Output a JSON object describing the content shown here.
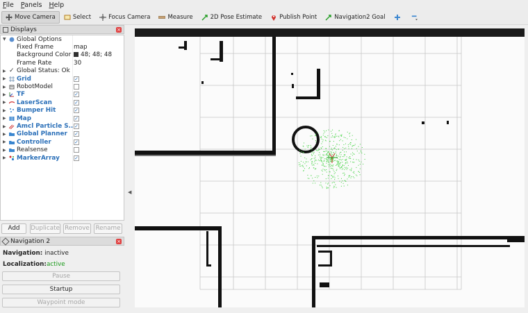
{
  "menubar": [
    "File",
    "Panels",
    "Help"
  ],
  "toolbar": {
    "tools": [
      "Move Camera",
      "Select",
      "Focus Camera",
      "Measure",
      "2D Pose Estimate",
      "Publish Point",
      "Navigation2 Goal"
    ]
  },
  "displays": {
    "title": "Displays",
    "rows": [
      {
        "label": "Global Options",
        "value": ""
      },
      {
        "label": "Fixed Frame",
        "value": "map"
      },
      {
        "label": "Background Color",
        "value": "48; 48; 48"
      },
      {
        "label": "Frame Rate",
        "value": "30"
      },
      {
        "label": "Global Status: Ok",
        "value": ""
      },
      {
        "label": "Grid",
        "value": ""
      },
      {
        "label": "RobotModel",
        "value": ""
      },
      {
        "label": "TF",
        "value": ""
      },
      {
        "label": "LaserScan",
        "value": ""
      },
      {
        "label": "Bumper Hit",
        "value": ""
      },
      {
        "label": "Map",
        "value": ""
      },
      {
        "label": "Amcl Particle S...",
        "value": ""
      },
      {
        "label": "Global Planner",
        "value": ""
      },
      {
        "label": "Controller",
        "value": ""
      },
      {
        "label": "Realsense",
        "value": ""
      },
      {
        "label": "MarkerArray",
        "value": ""
      }
    ],
    "checked": [
      true,
      false,
      true,
      true,
      true,
      true,
      true,
      true,
      true,
      false,
      true
    ]
  },
  "buttons": {
    "add": "Add",
    "duplicate": "Duplicate",
    "remove": "Remove",
    "rename": "Rename"
  },
  "nav2": {
    "title": "Navigation 2",
    "navigation_label": "Navigation:",
    "navigation_value": "inactive",
    "localization_label": "Localization:",
    "localization_value": "active",
    "pause": "Pause",
    "startup": "Startup",
    "waypoint": "Waypoint mode"
  },
  "colors": {
    "accent": "#2a6fb8",
    "active": "#1a9a1a",
    "particles": "#3bd13b"
  }
}
